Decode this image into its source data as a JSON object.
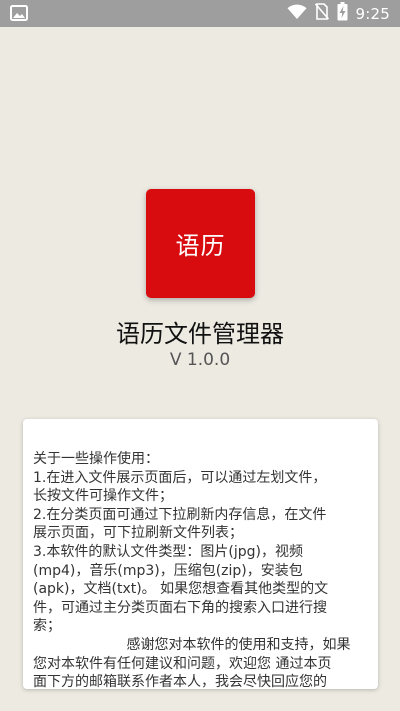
{
  "status_bar": {
    "time": "9:25",
    "icons": [
      "image-icon",
      "wifi-icon",
      "no-sim-icon",
      "battery-charging-icon"
    ]
  },
  "app": {
    "icon_label": "语历",
    "name": "语历文件管理器",
    "version": "V 1.0.0",
    "icon_color": "#d80c0f"
  },
  "info_card": {
    "lines": [
      "关于一些操作使用：",
      "1.在进入文件展示页面后，可以通过左划文件，",
      "长按文件可操作文件；",
      "2.在分类页面可通过下拉刷新内存信息，在文件",
      "展示页面，可下拉刷新文件列表；",
      "3.本软件的默认文件类型：图片(jpg)，视频",
      "(mp4)，音乐(mp3)，压缩包(zip)，安装包",
      "(apk)，文档(txt)。 如果您想查看其他类型的文",
      "件，可通过主分类页面右下角的搜索入口进行搜",
      "索；",
      "                     感谢您对本软件的使用和支持，如果",
      "您对本软件有任何建议和问题，欢迎您 通过本页",
      "面下方的邮箱联系作者本人，我会尽快回应您的"
    ]
  }
}
